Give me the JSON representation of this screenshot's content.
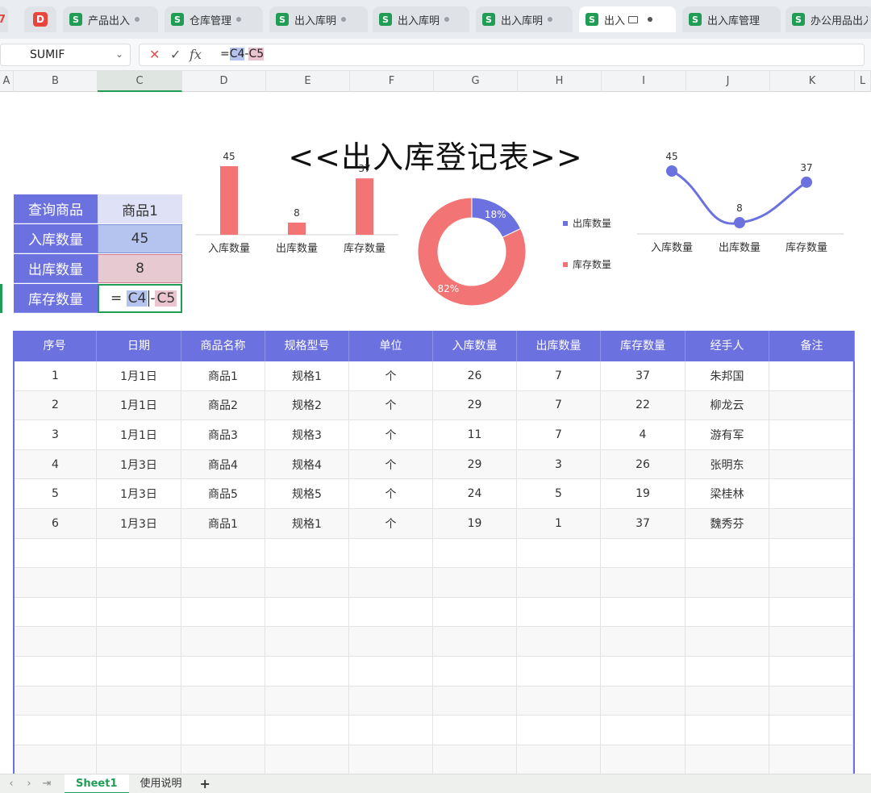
{
  "tabs": [
    {
      "label": "产品出入"
    },
    {
      "label": "仓库管理"
    },
    {
      "label": "出入库明"
    },
    {
      "label": "出入库明"
    },
    {
      "label": "出入库明"
    },
    {
      "label": "出入"
    },
    {
      "label": "出入库管理"
    },
    {
      "label": "办公用品出入"
    }
  ],
  "formula_bar": {
    "name_box": "SUMIF",
    "formula_prefix": "=",
    "formula_ref1": "C4",
    "formula_op": "-",
    "formula_ref2": "C5"
  },
  "columns": [
    "A",
    "B",
    "C",
    "D",
    "E",
    "F",
    "G",
    "H",
    "I",
    "J",
    "K",
    "L"
  ],
  "title": "<<出入库登记表>>",
  "query": {
    "rows": [
      {
        "label": "查询商品",
        "value": "商品1"
      },
      {
        "label": "入库数量",
        "value": "45"
      },
      {
        "label": "出库数量",
        "value": "8"
      },
      {
        "label": "库存数量",
        "value": ""
      }
    ],
    "edit_prefix": "=",
    "edit_ref1": "C4",
    "edit_op": "-",
    "edit_ref2": "C5"
  },
  "chart_data": [
    {
      "type": "bar",
      "categories": [
        "入库数量",
        "出库数量",
        "库存数量"
      ],
      "values": [
        45,
        8,
        37
      ],
      "color": "#f27474"
    },
    {
      "type": "pie",
      "labels": [
        "出库数量",
        "库存数量"
      ],
      "values": [
        18,
        82
      ],
      "percent_labels": [
        "18%",
        "82%"
      ],
      "colors": [
        "#6c71e0",
        "#f27474"
      ],
      "legend": "right"
    },
    {
      "type": "line",
      "categories": [
        "入库数量",
        "出库数量",
        "库存数量"
      ],
      "values": [
        45,
        8,
        37
      ],
      "color": "#6c71e0"
    }
  ],
  "table": {
    "headers": [
      "序号",
      "日期",
      "商品名称",
      "规格型号",
      "单位",
      "入库数量",
      "出库数量",
      "库存数量",
      "经手人",
      "备注"
    ],
    "rows": [
      [
        "1",
        "1月1日",
        "商品1",
        "规格1",
        "个",
        "26",
        "7",
        "37",
        "朱邦国",
        ""
      ],
      [
        "2",
        "1月1日",
        "商品2",
        "规格2",
        "个",
        "29",
        "7",
        "22",
        "柳龙云",
        ""
      ],
      [
        "3",
        "1月1日",
        "商品3",
        "规格3",
        "个",
        "11",
        "7",
        "4",
        "游有军",
        ""
      ],
      [
        "4",
        "1月3日",
        "商品4",
        "规格4",
        "个",
        "29",
        "3",
        "26",
        "张明东",
        ""
      ],
      [
        "5",
        "1月3日",
        "商品5",
        "规格5",
        "个",
        "24",
        "5",
        "19",
        "梁桂林",
        ""
      ],
      [
        "6",
        "1月3日",
        "商品1",
        "规格1",
        "个",
        "19",
        "1",
        "37",
        "魏秀芬",
        ""
      ]
    ],
    "empty_rows": 8
  },
  "sheets": {
    "tabs": [
      "Sheet1",
      "使用说明"
    ],
    "add_label": "+"
  },
  "colors": {
    "accent": "#6c71e0",
    "pink": "#f27474",
    "green": "#1f9d55"
  }
}
